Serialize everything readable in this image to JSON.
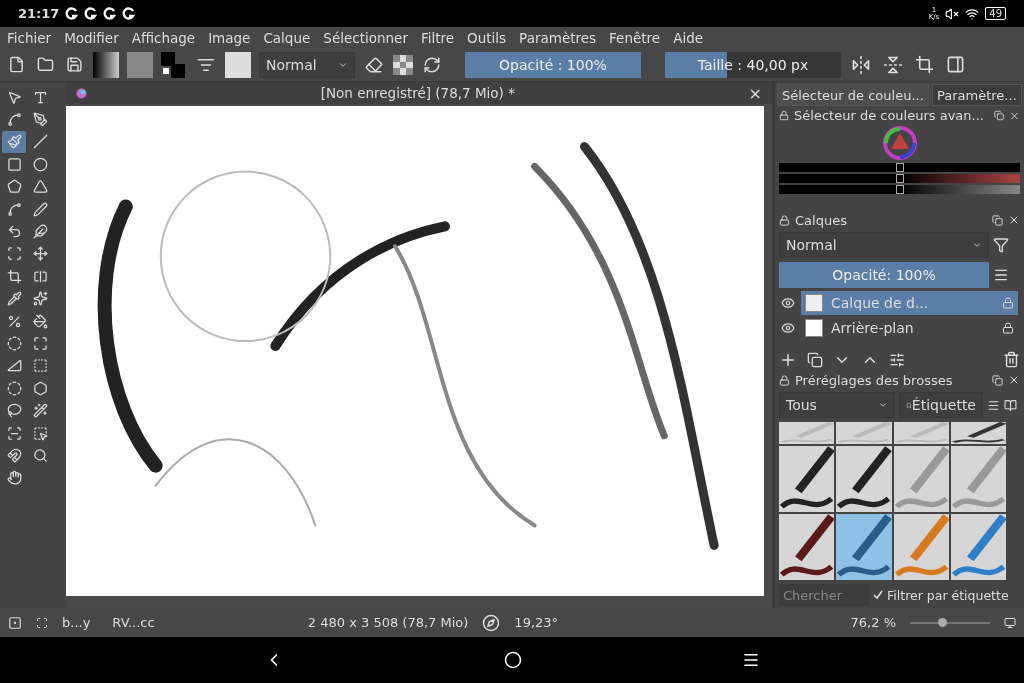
{
  "system_bar": {
    "time": "21:17",
    "net_speed": "1",
    "net_unit": "K/s",
    "battery": "49"
  },
  "menu": [
    "Fichier",
    "Modifier",
    "Affichage",
    "Image",
    "Calque",
    "Sélectionner",
    "Filtre",
    "Outils",
    "Paramètres",
    "Fenêtre",
    "Aide"
  ],
  "toolbar": {
    "blend_mode": "Normal",
    "opacity": {
      "label": "Opacité : 100%",
      "level": 1
    },
    "size": {
      "label": "Taille :  40,00 px",
      "level": 0.35
    }
  },
  "document_tab": {
    "title": "[Non enregistré]  (78,7 Mio) *",
    "close": "×"
  },
  "tools": [
    {
      "kind": "pointer",
      "selected": false
    },
    {
      "kind": "text",
      "selected": false
    },
    {
      "kind": "edit-shapes",
      "selected": false
    },
    {
      "kind": "calligraphy",
      "selected": false
    },
    {
      "kind": "brush",
      "selected": true
    },
    {
      "kind": "line",
      "selected": false
    },
    {
      "kind": "rectangle",
      "selected": false
    },
    {
      "kind": "ellipse",
      "selected": false
    },
    {
      "kind": "polygon",
      "selected": false
    },
    {
      "kind": "polyline",
      "selected": false
    },
    {
      "kind": "bezier",
      "selected": false
    },
    {
      "kind": "freehand-path",
      "selected": false
    },
    {
      "kind": "dynamic",
      "selected": false
    },
    {
      "kind": "multibrush",
      "selected": false
    },
    {
      "kind": "transform",
      "selected": false
    },
    {
      "kind": "move",
      "selected": false
    },
    {
      "kind": "crop",
      "selected": false
    },
    {
      "kind": "gradient",
      "selected": false
    },
    {
      "kind": "picker",
      "selected": false
    },
    {
      "kind": "colorize",
      "selected": false
    },
    {
      "kind": "smart-patch",
      "selected": false
    },
    {
      "kind": "fill",
      "selected": false
    },
    {
      "kind": "enclose",
      "selected": false
    },
    {
      "kind": "assistant",
      "selected": false
    },
    {
      "kind": "measure",
      "selected": false
    },
    {
      "kind": "rect-select",
      "selected": false
    },
    {
      "kind": "ellipse-select",
      "selected": false
    },
    {
      "kind": "poly-select",
      "selected": false
    },
    {
      "kind": "lasso-select",
      "selected": false
    },
    {
      "kind": "wand-select",
      "selected": false
    },
    {
      "kind": "similar-select",
      "selected": false
    },
    {
      "kind": "bezier-select",
      "selected": false
    },
    {
      "kind": "magnetic-select",
      "selected": false
    },
    {
      "kind": "zoom",
      "selected": false
    },
    {
      "kind": "pan",
      "selected": false
    }
  ],
  "dock_tabs": [
    {
      "label": "Sélecteur de couleu...",
      "selected": true
    },
    {
      "label": "Paramètre...",
      "selected": false
    }
  ],
  "color_docker": {
    "title": "Sélecteur de couleurs avan...",
    "sliders": [
      {
        "level": 0.5
      },
      {
        "level": 0.5
      },
      {
        "level": 0.5
      }
    ]
  },
  "layers_docker": {
    "title": "Calques",
    "blend_mode": "Normal",
    "opacity": {
      "label": "Opacité:  100%",
      "level": 1
    },
    "layers": [
      {
        "name": "Calque de d...",
        "selected": true,
        "visible": true,
        "kind": "sketch"
      },
      {
        "name": "Arrière-plan",
        "selected": false,
        "visible": true,
        "kind": "white"
      }
    ]
  },
  "brushes_docker": {
    "title": "Préréglages des brosses",
    "filter": "Tous",
    "tag": "Étiquette",
    "presets": [
      {
        "kind": "dots",
        "selected": false
      },
      {
        "kind": "dots",
        "selected": false
      },
      {
        "kind": "dots",
        "selected": false
      },
      {
        "kind": "blur",
        "selected": false
      },
      {
        "kind": "pen-dark",
        "selected": false
      },
      {
        "kind": "pen-dark",
        "selected": false
      },
      {
        "kind": "pen-light",
        "selected": false
      },
      {
        "kind": "pen-light",
        "selected": false
      },
      {
        "kind": "brush-red",
        "selected": false
      },
      {
        "kind": "brush-blue",
        "selected": true
      },
      {
        "kind": "brush-orange",
        "selected": false
      },
      {
        "kind": "pencil-blue",
        "selected": false
      }
    ],
    "search_placeholder": "Chercher",
    "filter_by_tag": {
      "label": "Filtrer par étiquette",
      "checked": true
    }
  },
  "status_bar": {
    "brush": "b...y",
    "color_space": "RV...cc",
    "dimensions": "2 480 x 3 508 (78,7 Mio)",
    "rotation": "19,23°",
    "zoom": "76,2 %",
    "zoom_slider": {
      "level": 0.4
    }
  }
}
